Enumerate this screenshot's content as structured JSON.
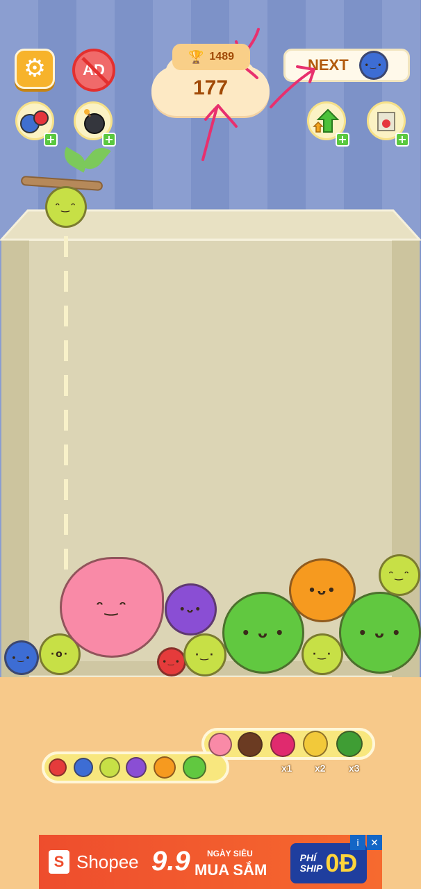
{
  "hud": {
    "best_score": "1489",
    "score": "177",
    "next_label": "NEXT",
    "settings_icon": "gear-icon",
    "no_ads_label": "AD",
    "trophy_icon": "trophy-icon"
  },
  "powerups": {
    "left": [
      {
        "name": "fruit-swap",
        "badge": "+"
      },
      {
        "name": "bomb",
        "badge": "+"
      }
    ],
    "right": [
      {
        "name": "upgrade-arrow",
        "badge": "+"
      },
      {
        "name": "shake-box",
        "badge": "+"
      }
    ]
  },
  "evolution": {
    "multipliers": [
      "x1",
      "x2",
      "x3"
    ]
  },
  "ad": {
    "brand_mark": "S",
    "brand": "Shopee",
    "date": "9.9",
    "line_small": "NGÀY SIÊU",
    "line_main": "MUA SẮM",
    "freeship_small": "PHÍ\nSHIP",
    "freeship_big": "0Đ",
    "info_label": "i",
    "close_label": "✕"
  },
  "colors": {
    "accent_orange": "#f7b32b",
    "score_brown": "#a14a07",
    "annotation": "#e8306e",
    "bg_stripe": "#8b9ed0"
  }
}
